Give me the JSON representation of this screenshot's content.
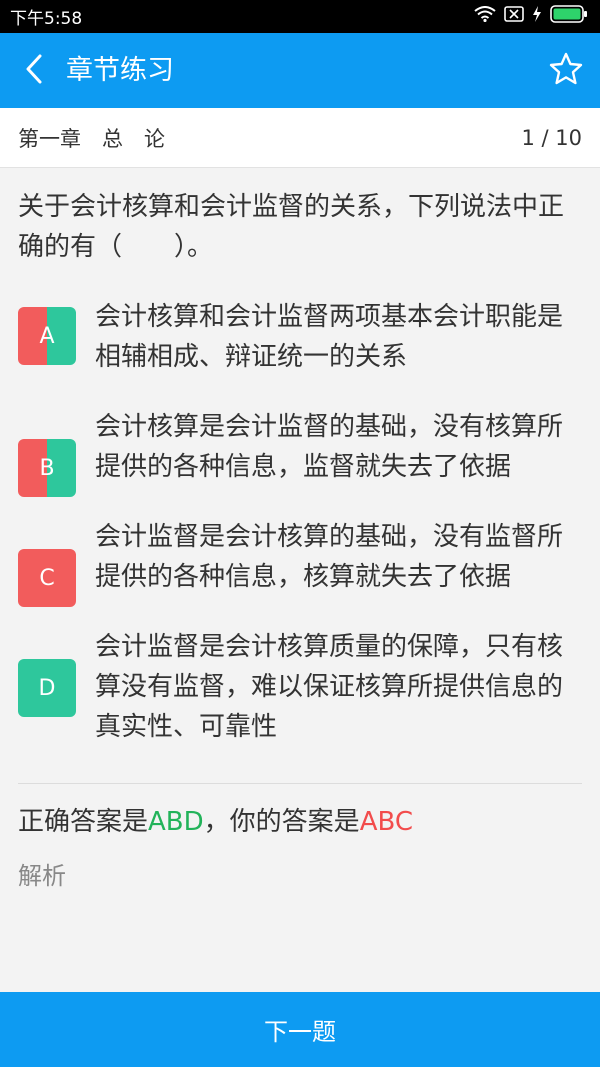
{
  "status": {
    "time": "下午5:58"
  },
  "appbar": {
    "title": "章节练习"
  },
  "chapter": {
    "name": "第一章　总　论",
    "progress": "1 / 10"
  },
  "question": {
    "text": "关于会计核算和会计监督的关系，下列说法中正确的有（　　）。"
  },
  "options": [
    {
      "letter": "A",
      "text": "会计核算和会计监督两项基本会计职能是相辅相成、辩证统一的关系"
    },
    {
      "letter": "B",
      "text": "会计核算是会计监督的基础，没有核算所提供的各种信息，监督就失去了依据"
    },
    {
      "letter": "C",
      "text": "会计监督是会计核算的基础，没有监督所提供的各种信息，核算就失去了依据"
    },
    {
      "letter": "D",
      "text": "会计监督是会计核算质量的保障，只有核算没有监督，难以保证核算所提供信息的真实性、可靠性"
    }
  ],
  "answer": {
    "correct_prefix": "正确答案是",
    "correct": "ABD",
    "yours_prefix": "，你的答案是",
    "yours": "ABC"
  },
  "analysis": {
    "title": "解析"
  },
  "footer": {
    "next_label": "下一题"
  },
  "colors": {
    "accent": "#0d9bf2",
    "correct": "#22b35a",
    "wrong": "#f24c4c",
    "red_badge": "#f25c5c",
    "green_badge": "#2ec79c"
  }
}
